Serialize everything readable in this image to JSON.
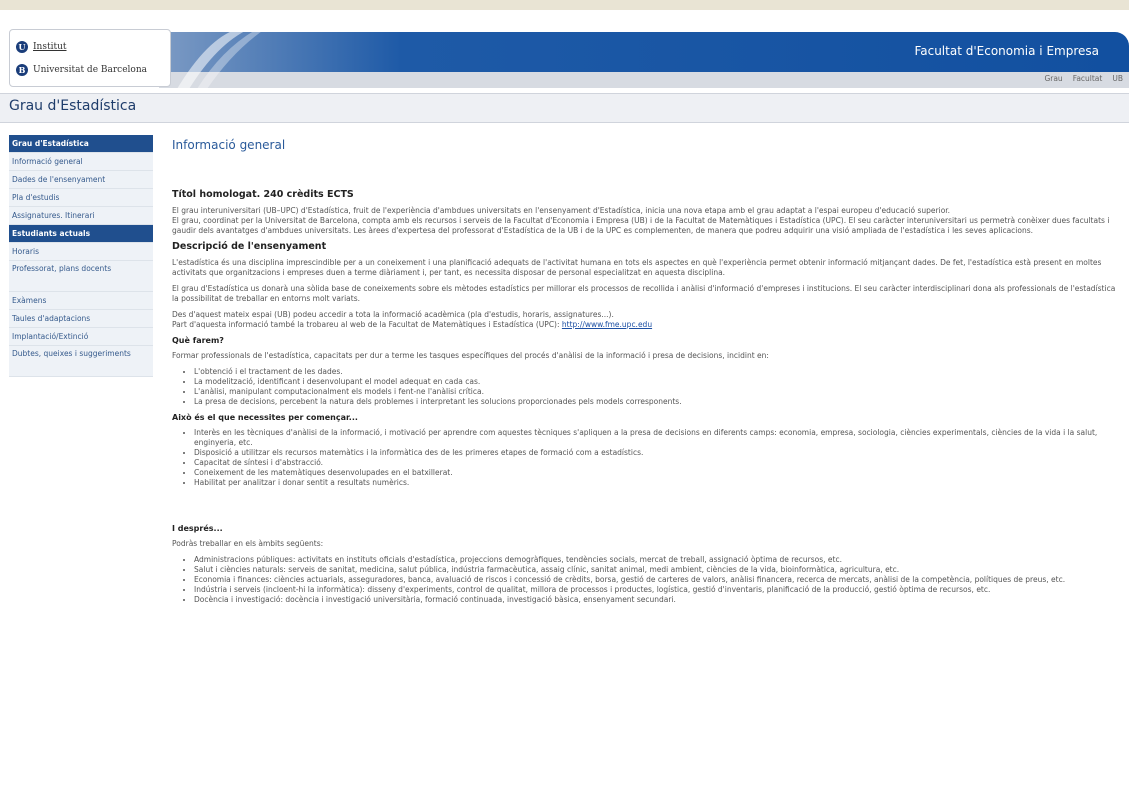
{
  "header": {
    "logo_line1": "Institut",
    "logo_line2": "Universitat de Barcelona",
    "faculty": "Facultat d'Economia i Empresa",
    "toplinks": [
      "Grau",
      "Facultat",
      "UB"
    ]
  },
  "page": {
    "title": "Grau d'Estadística"
  },
  "sidebar": {
    "items": [
      {
        "label": "Grau d'Estadística",
        "head": true
      },
      {
        "label": "Informació general"
      },
      {
        "label": "Dades de l'ensenyament"
      },
      {
        "label": "Pla d'estudis"
      },
      {
        "label": "Assignatures. Itinerari"
      },
      {
        "label": "Estudiants actuals",
        "head": true
      },
      {
        "label": "Horaris"
      },
      {
        "label": "Professorat, plans docents"
      },
      {
        "label": "Exàmens"
      },
      {
        "label": "Taules d'adaptacions"
      },
      {
        "label": "Implantació/Extinció"
      },
      {
        "label": "Dubtes, queixes i suggeriments"
      }
    ]
  },
  "main": {
    "title": "Informació general",
    "s1_title": "Títol homologat. 240 crèdits ECTS",
    "s1_p1": "El grau interuniversitari (UB–UPC) d'Estadística, fruit de l'experiència d'ambdues universitats en l'ensenyament d'Estadística, inicia una nova etapa amb el grau adaptat a l'espai europeu d'educació superior.",
    "s1_p2": "El grau, coordinat per la Universitat de Barcelona, compta amb els recursos i serveis de la Facultat d'Economia i Empresa (UB) i de la Facultat de Matemàtiques i Estadística (UPC). El seu caràcter interuniversitari us permetrà conèixer dues facultats i gaudir dels avantatges d'ambdues universitats. Les àrees d'expertesa del professorat d'Estadística de la UB i de la UPC es complementen, de manera que podreu adquirir una visió ampliada de l'estadística i les seves aplicacions.",
    "s2_title": "Descripció de l'ensenyament",
    "s2_p1": "L'estadística és una disciplina imprescindible per a un coneixement i una planificació adequats de l'activitat humana en tots els aspectes en què l'experiència permet obtenir informació mitjançant dades. De fet, l'estadística està present en moltes activitats que organitzacions i empreses duen a terme diàriament i, per tant, es necessita disposar de personal especialitzat en aquesta disciplina.",
    "s2_p2": "El grau d'Estadística us donarà una sòlida base de coneixements sobre els mètodes estadístics per millorar els processos de recollida i anàlisi d'informació d'empreses i institucions. El seu caràcter interdisciplinari dona als professionals de l'estadística la possibilitat de treballar en entorns molt variats.",
    "s2_p3": "Des d'aquest mateix espai (UB) podeu accedir a tota la informació acadèmica (pla d'estudis, horaris, assignatures...).",
    "s2_p4_text": "Part d'aquesta informació també la trobareu al web de la Facultat de Matemàtiques i Estadística (UPC):",
    "s2_link": "http://www.fme.upc.edu",
    "s3_title": "Què farem?",
    "s3_p": "Formar professionals de l'estadística, capacitats per dur a terme les tasques específiques del procés d'anàlisi de la informació i presa de decisions, incidint en:",
    "s3_list": [
      "L'obtenció i el tractament de les dades.",
      "La modelització, identificant i desenvolupant el model adequat en cada cas.",
      "L'anàlisi, manipulant computacionalment els models i fent-ne l'anàlisi crítica.",
      "La presa de decisions, percebent la natura dels problemes i interpretant les solucions proporcionades pels models corresponents."
    ],
    "s4_title": "Això és el que necessites per començar...",
    "s4_list": [
      "Interès en les tècniques d'anàlisi de la informació, i motivació per aprendre com aquestes tècniques s'apliquen a la presa de decisions en diferents camps: economia, empresa, sociologia, ciències experimentals, ciències de la vida i la salut, enginyeria, etc.",
      "Disposició a utilitzar els recursos matemàtics i la informàtica des de les primeres etapes de formació com a estadístics.",
      "Capacitat de síntesi i d'abstracció.",
      "Coneixement de les matemàtiques desenvolupades en el batxillerat.",
      "Habilitat per analitzar i donar sentit a resultats numèrics."
    ],
    "s5_title": "I després...",
    "s5_p": "Podràs treballar en els àmbits següents:",
    "s5_list": [
      "Administracions públiques: activitats en instituts oficials d'estadística, projeccions demogràfiques, tendències socials, mercat de treball, assignació òptima de recursos, etc.",
      "Salut i ciències naturals: serveis de sanitat, medicina, salut pública, indústria farmacèutica, assaig clínic, sanitat animal, medi ambient, ciències de la vida, bioinformàtica, agricultura, etc.",
      "Economia i finances: ciències actuarials, asseguradores, banca, avaluació de riscos i concessió de crèdits, borsa, gestió de carteres de valors, anàlisi financera, recerca de mercats, anàlisi de la competència, polítiques de preus, etc.",
      "Indústria i serveis (incloent-hi la informàtica): disseny d'experiments, control de qualitat, millora de processos i productes, logística, gestió d'inventaris, planificació de la producció, gestió òptima de recursos, etc.",
      "Docència i investigació: docència i investigació universitària, formació continuada, investigació bàsica, ensenyament secundari."
    ]
  }
}
